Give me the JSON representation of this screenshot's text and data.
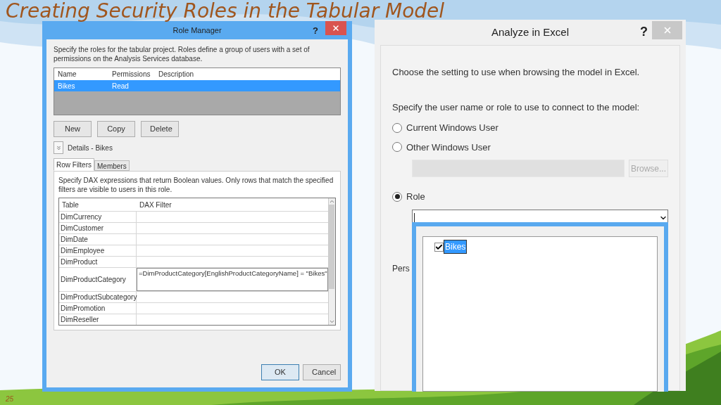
{
  "slide": {
    "title": "Creating Security Roles in the Tabular Model",
    "number": "25"
  },
  "role_manager": {
    "title": "Role Manager",
    "help": "?",
    "description": "Specify the roles for the tabular project. Roles define a group of users with a set of permissions on the Analysis Services database.",
    "roles_table": {
      "columns": [
        "Name",
        "Permissions",
        "Description"
      ],
      "rows": [
        {
          "cells": [
            "Bikes",
            "Read"
          ],
          "selected": true
        }
      ]
    },
    "buttons": [
      "New",
      "Copy",
      "Delete"
    ],
    "details_label": "Details - Bikes",
    "tabs": [
      {
        "label": "Row Filters",
        "selected": true
      },
      {
        "label": "Members",
        "selected": false
      }
    ],
    "filter_hint": "Specify DAX expressions that return Boolean values. Only rows that match the specified filters are visible to users in this role.",
    "filters_table": {
      "columns": [
        "Table",
        "DAX Filter"
      ],
      "rows": [
        {
          "table": "DimCurrency"
        },
        {
          "table": "DimCustomer"
        },
        {
          "table": "DimDate"
        },
        {
          "table": "DimEmployee"
        },
        {
          "table": "DimProduct"
        },
        {
          "table": "DimProductCategory",
          "filter": "=DimProductCategory[EnglishProductCategoryName] = \"Bikes\""
        },
        {
          "table": "DimProductSubcategory"
        },
        {
          "table": "DimPromotion"
        },
        {
          "table": "DimReseller"
        }
      ]
    },
    "footer_buttons": [
      {
        "label": "OK",
        "default": true
      },
      {
        "label": "Cancel",
        "default": false
      }
    ]
  },
  "analyze_in_excel": {
    "title": "Analyze in Excel",
    "help": "?",
    "prompt": "Choose the setting to use when browsing the model in Excel.",
    "question": "Specify the user name or role to use to connect to the model:",
    "options": [
      {
        "kind": "plain",
        "label": "Current Windows User",
        "selected": false
      },
      {
        "kind": "user",
        "label": "Other Windows User",
        "selected": false,
        "browse": "Browse..."
      },
      {
        "kind": "role",
        "label": "Role",
        "selected": true
      }
    ],
    "role_dropdown": {
      "expanded": true,
      "items": [
        {
          "label": "Bikes",
          "checked": true,
          "selected": true
        }
      ]
    },
    "perspective_label": "Pers"
  }
}
